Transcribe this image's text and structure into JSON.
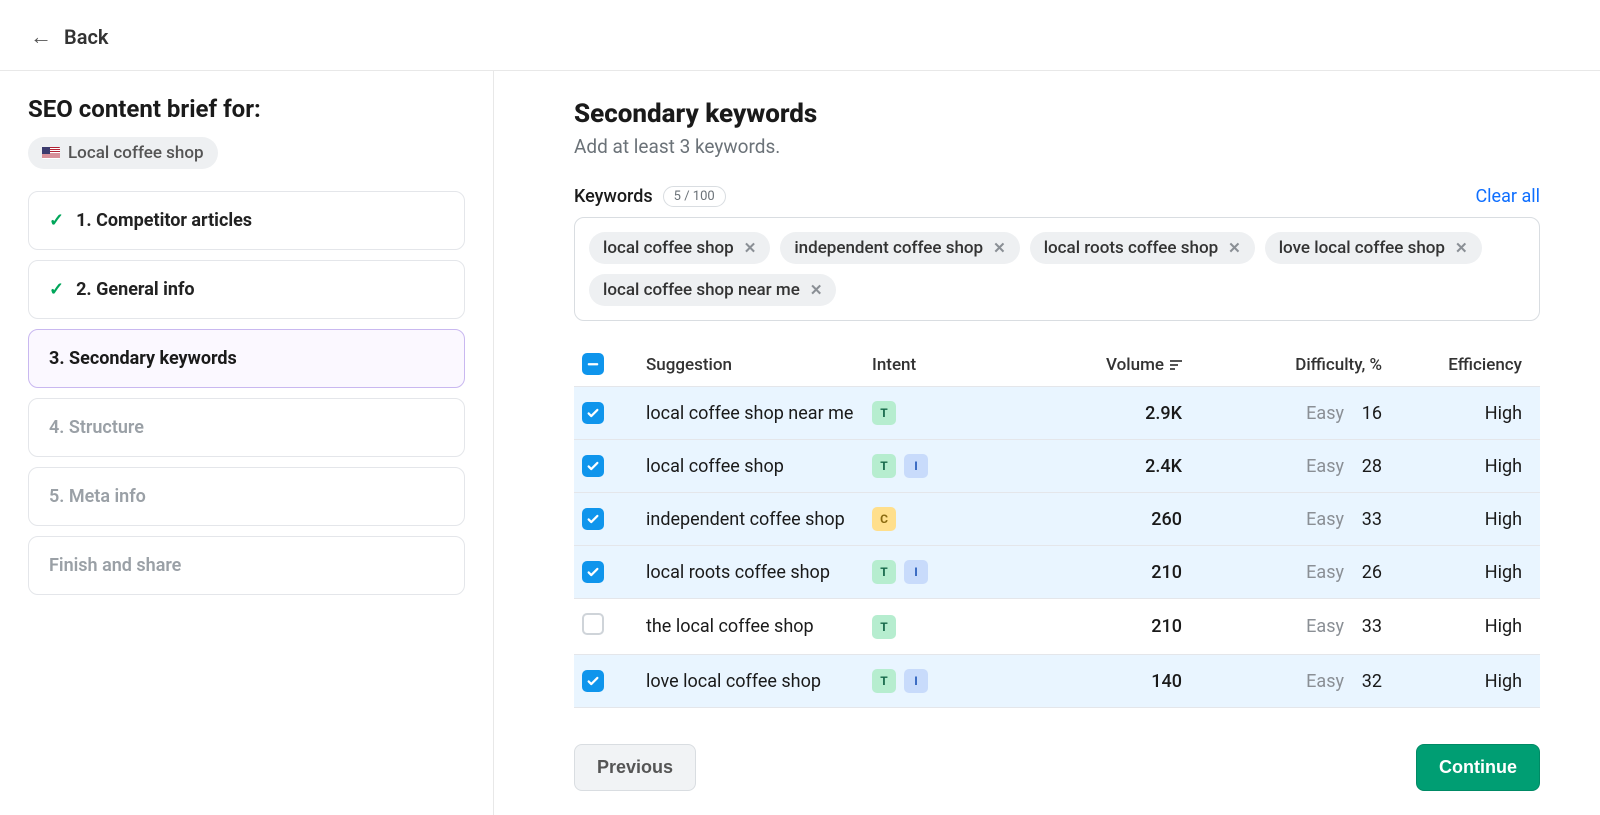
{
  "topbar": {
    "back": "Back"
  },
  "sidebar": {
    "title": "SEO content brief for:",
    "primary_keyword": "Local coffee shop",
    "steps": [
      {
        "label": "1. Competitor articles",
        "state": "done"
      },
      {
        "label": "2. General info",
        "state": "done"
      },
      {
        "label": "3. Secondary keywords",
        "state": "active"
      },
      {
        "label": "4. Structure",
        "state": "disabled"
      },
      {
        "label": "5. Meta info",
        "state": "disabled"
      },
      {
        "label": "Finish and share",
        "state": "disabled"
      }
    ]
  },
  "main": {
    "heading": "Secondary keywords",
    "subtitle": "Add at least 3 keywords.",
    "keywords_label": "Keywords",
    "counter": "5 / 100",
    "clear_all": "Clear all",
    "selected_keywords": [
      "local coffee shop",
      "independent coffee shop",
      "local roots coffee shop",
      "love local coffee shop",
      "local coffee shop near me"
    ],
    "columns": {
      "suggestion": "Suggestion",
      "intent": "Intent",
      "volume": "Volume",
      "difficulty": "Difficulty, %",
      "efficiency": "Efficiency"
    },
    "rows": [
      {
        "selected": true,
        "suggestion": "local coffee shop near me",
        "intents": [
          "T"
        ],
        "volume": "2.9K",
        "diff_label": "Easy",
        "diff_val": "16",
        "efficiency": "High"
      },
      {
        "selected": true,
        "suggestion": "local coffee shop",
        "intents": [
          "T",
          "I"
        ],
        "volume": "2.4K",
        "diff_label": "Easy",
        "diff_val": "28",
        "efficiency": "High"
      },
      {
        "selected": true,
        "suggestion": "independent coffee shop",
        "intents": [
          "C"
        ],
        "volume": "260",
        "diff_label": "Easy",
        "diff_val": "33",
        "efficiency": "High"
      },
      {
        "selected": true,
        "suggestion": "local roots coffee shop",
        "intents": [
          "T",
          "I"
        ],
        "volume": "210",
        "diff_label": "Easy",
        "diff_val": "26",
        "efficiency": "High"
      },
      {
        "selected": false,
        "suggestion": "the local coffee shop",
        "intents": [
          "T"
        ],
        "volume": "210",
        "diff_label": "Easy",
        "diff_val": "33",
        "efficiency": "High"
      },
      {
        "selected": true,
        "suggestion": "love local coffee shop",
        "intents": [
          "T",
          "I"
        ],
        "volume": "140",
        "diff_label": "Easy",
        "diff_val": "32",
        "efficiency": "High"
      }
    ],
    "footer": {
      "previous": "Previous",
      "continue": "Continue"
    }
  }
}
